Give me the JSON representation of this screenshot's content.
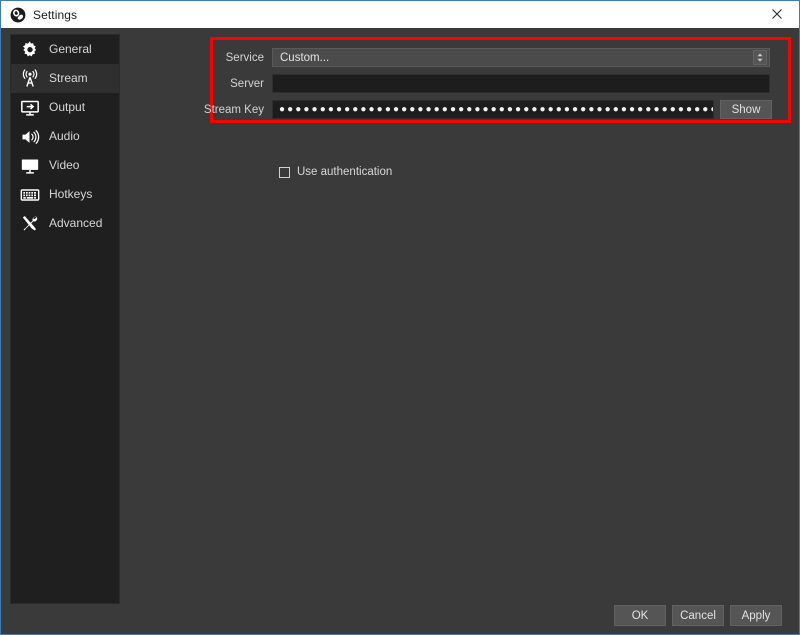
{
  "window": {
    "title": "Settings",
    "app_icon": "obs-logo-icon",
    "close_label": "×",
    "border_color": "#3e7cb1"
  },
  "sidebar": {
    "items": [
      {
        "label": "General",
        "icon": "gear-icon",
        "selected": false
      },
      {
        "label": "Stream",
        "icon": "broadcast-tower-icon",
        "selected": true
      },
      {
        "label": "Output",
        "icon": "monitor-arrow-icon",
        "selected": false
      },
      {
        "label": "Audio",
        "icon": "speaker-icon",
        "selected": false
      },
      {
        "label": "Video",
        "icon": "monitor-icon",
        "selected": false
      },
      {
        "label": "Hotkeys",
        "icon": "keyboard-icon",
        "selected": false
      },
      {
        "label": "Advanced",
        "icon": "wrench-screwdriver-icon",
        "selected": false
      }
    ]
  },
  "stream_settings": {
    "service": {
      "label": "Service",
      "value": "Custom...",
      "spinner_icon": "up-down-chevron-icon"
    },
    "server": {
      "label": "Server",
      "value": "",
      "placeholder": ""
    },
    "stream_key": {
      "label": "Stream Key",
      "masked_value": "●●●●●●●●●●●●●●●●●●●●●●●●●●●●●●●●●●●●●●●●●●●●●●●●●●●●●●●●●●●●●●●●●●●●●●●●●●●●●●●●●●●●●●●●●●●●●●●●●●●●●●●●●●●●●●●●●●●●●●●●●●●●●●●●●●●●●●●",
      "show_button_label": "Show"
    },
    "use_authentication": {
      "label": "Use authentication",
      "checked": false
    }
  },
  "annotation": {
    "highlight_color": "#ff0000"
  },
  "footer": {
    "ok_label": "OK",
    "cancel_label": "Cancel",
    "apply_label": "Apply"
  }
}
